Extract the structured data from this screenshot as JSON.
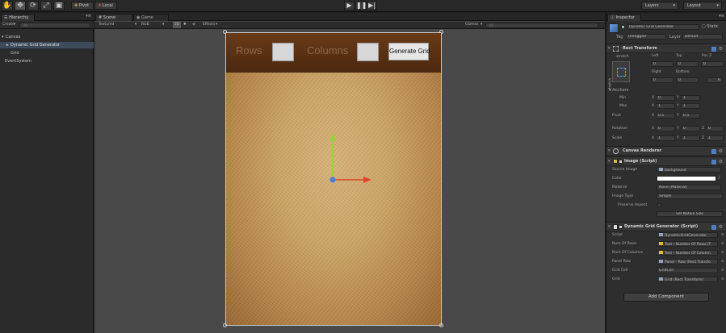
{
  "toolbar": {
    "pivot": "Pivot",
    "local": "Local",
    "layers": "Layers",
    "layout": "Layout"
  },
  "hierarchy": {
    "tab": "Hierarchy",
    "create": "Create",
    "search_placeholder": "All",
    "items": [
      "Canvas",
      "Dynamic Grid Generator",
      "Grid",
      "EventSystem"
    ]
  },
  "scene": {
    "tab_scene": "Scene",
    "tab_game": "Game",
    "shading": "Textured",
    "render_mode": "RGB",
    "mode_2d": "2D",
    "effects": "Effects",
    "gizmos": "Gizmos",
    "search_placeholder": "All"
  },
  "game_ui": {
    "rows_label": "Rows",
    "columns_label": "Columns",
    "generate_button": "Generate Grid"
  },
  "inspector": {
    "tab": "Inspector",
    "object_name": "Dynamic Grid Generator",
    "static": "Static",
    "tag_label": "Tag",
    "tag_value": "Untagged",
    "layer_label": "Layer",
    "layer_value": "Default",
    "rect_transform": {
      "title": "Rect Transform",
      "stretch": "stretch",
      "stretch_v": "stretch",
      "left_label": "Left",
      "top_label": "Top",
      "posz_label": "Pos Z",
      "left": "0",
      "top": "0",
      "posz": "0",
      "right_label": "Right",
      "bottom_label": "Bottom",
      "right": "0",
      "bottom": "0",
      "r_button": "R",
      "anchors": "Anchors",
      "min": "Min",
      "max": "Max",
      "pivot": "Pivot",
      "min_x": "0",
      "min_y": "1",
      "max_x": "1",
      "max_y": "1",
      "pivot_x": "0.5",
      "pivot_y": "0.5",
      "rotation": "Rotation",
      "scale": "Scale",
      "rot_x": "0",
      "rot_y": "0",
      "rot_z": "0",
      "scale_x": "1",
      "scale_y": "1",
      "scale_z": "1"
    },
    "canvas_renderer": "Canvas Renderer",
    "image": {
      "title": "Image (Script)",
      "source_image_label": "Source Image",
      "source_image": "background",
      "color_label": "Color",
      "material_label": "Material",
      "material": "None (Material)",
      "image_type_label": "Image Type",
      "image_type": "Simple",
      "preserve_aspect_label": "Preserve Aspect",
      "set_native": "Set Native Size"
    },
    "dgg": {
      "title": "Dynamic Grid Generator (Script)",
      "script_label": "Script",
      "script": "DynamicGridGenerator",
      "num_rows_label": "Num Of Rows",
      "num_rows": "Text - Number Of Rows (T",
      "num_cols_label": "Num Of Columns",
      "num_cols": "Text - Number Of Column",
      "panel_row_label": "Panel Row",
      "panel_row": "Panel - Row (Rect Transfo",
      "grid_cell_label": "Grid Cell",
      "grid_cell": "GridCell",
      "grid_label": "Grid",
      "grid": "Grid (Rect Transform)"
    },
    "add_component": "Add Component"
  },
  "colors": {
    "selection": "#3c4a5c",
    "panel_row": "#5a3115",
    "background_image": "#cfa766",
    "gizmo_x": "#e0452a",
    "gizmo_y": "#9bd13a",
    "gizmo_center": "#4a80d8"
  }
}
